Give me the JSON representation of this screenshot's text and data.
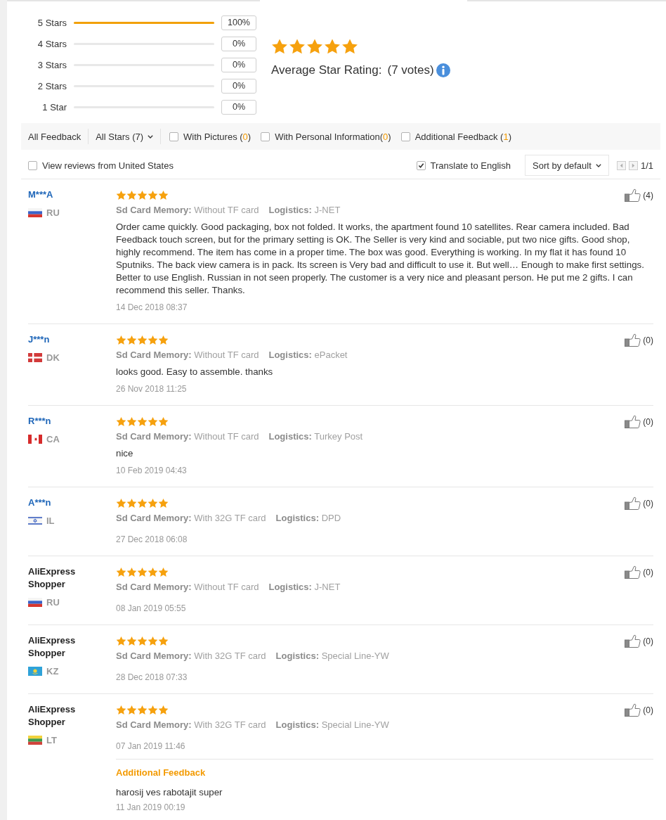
{
  "rating_summary": {
    "histogram": [
      {
        "label": "5 Stars",
        "level": 1,
        "reading": "100%"
      },
      {
        "label": "4 Stars",
        "level": 0,
        "reading": "0%"
      },
      {
        "label": "3 Stars",
        "level": 0,
        "reading": "0%"
      },
      {
        "label": "2 Stars",
        "level": 0,
        "reading": "0%"
      },
      {
        "label": "1 Star",
        "level": 0,
        "reading": "0%"
      }
    ],
    "average": {
      "stars": 5,
      "label": "Average Star Rating:",
      "votes": "(7 votes)"
    }
  },
  "filter_bar": {
    "all_feedback": "All Feedback",
    "star_filter": "All Stars (7)",
    "checkboxes": [
      {
        "label": "With Pictures (",
        "count": "0",
        "close": ")",
        "checked": false
      },
      {
        "label": "With Personal Information(",
        "count": "0",
        "close": ")",
        "checked": false
      },
      {
        "label": "Additional Feedback (",
        "count": "1",
        "close": ")",
        "checked": false
      }
    ]
  },
  "options_bar": {
    "country_filter": {
      "label": "View reviews from United States",
      "checked": false
    },
    "translate": {
      "label": "Translate to English",
      "checked": true
    },
    "sort": "Sort by default",
    "pager": "1/1"
  },
  "reviews": [
    {
      "name": "M***A",
      "linked": true,
      "flag": {
        "kind": "russia"
      },
      "country": "RU",
      "stars": 5,
      "attributes": [
        {
          "label": "Sd Card Memory:",
          "value": "Without TF card"
        },
        {
          "label": "Logistics:",
          "value": "J-NET"
        }
      ],
      "text": "Order came quickly. Good packaging, box not folded. It works, the apartment found 10 satellites. Rear camera included. Bad Feedback touch screen, but for the primary setting is OK. The Seller is very kind and sociable, put two nice gifts. Good shop, highly recommend. The item has come in a proper time. The box was good. Everything is working. In my flat it has found 10 Sputniks. The back view camera is in pack. Its screen is Very bad and difficult to use it. But well… Enough to make first settings. Better to use English. Russian in not seen properly. The customer is a very nice and pleasant person. He put me 2 gifts. I can recommend this seller. Thanks.",
      "date": "14 Dec 2018 08:37",
      "likes": "(4)"
    },
    {
      "name": "J***n",
      "linked": true,
      "flag": {
        "kind": "denmark"
      },
      "country": "DK",
      "stars": 5,
      "attributes": [
        {
          "label": "Sd Card Memory:",
          "value": "Without TF card"
        },
        {
          "label": "Logistics:",
          "value": "ePacket"
        }
      ],
      "text": "looks good. Easy to assemble. thanks",
      "date": "26 Nov 2018 11:25",
      "likes": "(0)"
    },
    {
      "name": "R***n",
      "linked": true,
      "flag": {
        "kind": "canada"
      },
      "country": "CA",
      "stars": 5,
      "attributes": [
        {
          "label": "Sd Card Memory:",
          "value": "Without TF card"
        },
        {
          "label": "Logistics:",
          "value": "Turkey Post"
        }
      ],
      "text": "nice",
      "date": "10 Feb 2019 04:43",
      "likes": "(0)"
    },
    {
      "name": "A***n",
      "linked": true,
      "flag": {
        "kind": "israel"
      },
      "country": "IL",
      "stars": 5,
      "attributes": [
        {
          "label": "Sd Card Memory:",
          "value": "With 32G TF card"
        },
        {
          "label": "Logistics:",
          "value": "DPD"
        }
      ],
      "date": "27 Dec 2018 06:08",
      "likes": "(0)"
    },
    {
      "name": "AliExpress Shopper",
      "linked": false,
      "flag": {
        "kind": "russia"
      },
      "country": "RU",
      "stars": 5,
      "attributes": [
        {
          "label": "Sd Card Memory:",
          "value": "Without TF card"
        },
        {
          "label": "Logistics:",
          "value": "J-NET"
        }
      ],
      "date": "08 Jan 2019 05:55",
      "likes": "(0)"
    },
    {
      "name": "AliExpress Shopper",
      "linked": false,
      "flag": {
        "kind": "kazakhstan"
      },
      "country": "KZ",
      "stars": 5,
      "attributes": [
        {
          "label": "Sd Card Memory:",
          "value": "With 32G TF card"
        },
        {
          "label": "Logistics:",
          "value": "Special Line-YW"
        }
      ],
      "date": "28 Dec 2018 07:33",
      "likes": "(0)"
    },
    {
      "name": "AliExpress Shopper",
      "linked": false,
      "flag": {
        "kind": "lithuania"
      },
      "country": "LT",
      "stars": 5,
      "attributes": [
        {
          "label": "Sd Card Memory:",
          "value": "With 32G TF card"
        },
        {
          "label": "Logistics:",
          "value": "Special Line-YW"
        }
      ],
      "date": "07 Jan 2019 11:46",
      "likes": "(0)",
      "additional_feedback": {
        "title": "Additional Feedback",
        "text": "harosij ves rabotajit super",
        "date": "11 Jan 2019 00:19"
      }
    }
  ]
}
